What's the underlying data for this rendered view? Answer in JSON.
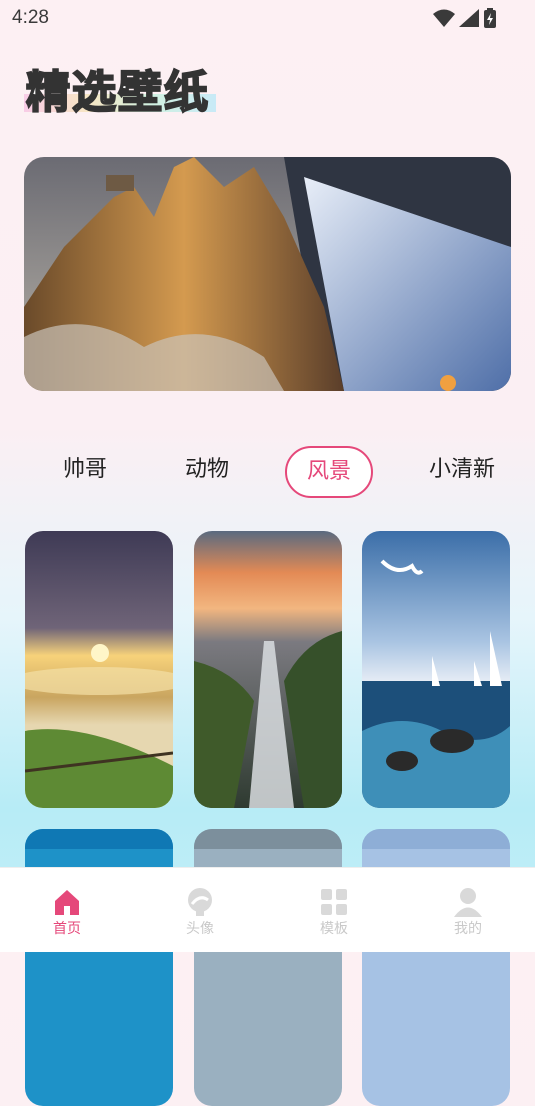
{
  "status_bar": {
    "time": "4:28",
    "icons": [
      "wifi-icon",
      "signal-icon",
      "battery-icon"
    ]
  },
  "header": {
    "title": "精选壁纸"
  },
  "banner": {
    "image": "mountain-peak-snow-banner"
  },
  "tabs": [
    {
      "label": "帅哥",
      "active": false
    },
    {
      "label": "动物",
      "active": false
    },
    {
      "label": "风景",
      "active": true
    },
    {
      "label": "小清新",
      "active": false
    }
  ],
  "wallpapers": [
    {
      "name": "sunset-clouds-meadow"
    },
    {
      "name": "sunset-rocks-waterfall"
    },
    {
      "name": "seagull-sailboats-sea"
    },
    {
      "name": "blue-sky"
    },
    {
      "name": "grey-sky"
    },
    {
      "name": "light-sky"
    }
  ],
  "bottom_nav": [
    {
      "label": "首页",
      "icon": "home-icon",
      "active": true
    },
    {
      "label": "头像",
      "icon": "avatar-icon",
      "active": false
    },
    {
      "label": "模板",
      "icon": "template-icon",
      "active": false
    },
    {
      "label": "我的",
      "icon": "user-icon",
      "active": false
    }
  ],
  "colors": {
    "accent": "#e5487a",
    "inactive": "#c9c9c9"
  }
}
